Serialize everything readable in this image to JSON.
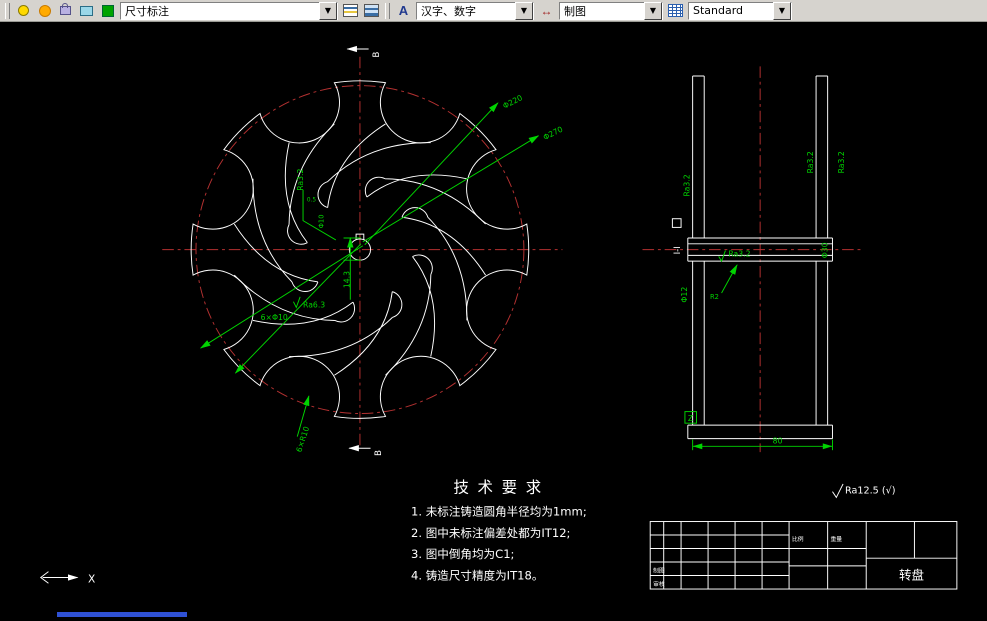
{
  "toolbar": {
    "layer_display": "尺寸标注",
    "text_style": "汉字、数字",
    "dim_layer": "制图",
    "dim_style": "Standard"
  },
  "left_view": {
    "phi220": "Φ220",
    "phi270": "Φ270",
    "holes": "6×Φ10",
    "ra63": "Ra6.3",
    "r10": "6×R10",
    "ra32": "Ra3.2",
    "key_dim": "14.3",
    "bore": "Φ10",
    "bore_tol": "0.5",
    "section_top": "B",
    "section_bottom": "B"
  },
  "right_view": {
    "section": "I-I",
    "ra32_left": "Ra3.2",
    "ra32_right_inner": "Ra3.2",
    "ra32_right_outer": "Ra3.2",
    "ra32_hub": "Ra3.2",
    "phi30": "Φ30",
    "phi12": "Φ12",
    "r2": "R2",
    "width": "80",
    "datum": "Z"
  },
  "notes": {
    "surface_note": "Ra12.5 (√)"
  },
  "tech_requirements": {
    "title": "技术要求",
    "items": [
      "1. 未标注铸造圆角半径均为1mm;",
      "2. 图中未标注偏差处都为IT12;",
      "3. 图中倒角均为C1;",
      "4. 铸造尺寸精度为IT18。"
    ]
  },
  "title_block": {
    "part_name": "转盘",
    "labels": [
      "制图",
      "审核",
      "比例",
      "重量"
    ]
  },
  "ucs": {
    "x_axis": "X"
  },
  "colors": {
    "dim_green": "#00d400",
    "centerline_red": "#b43131",
    "line_white": "#ffffff"
  }
}
